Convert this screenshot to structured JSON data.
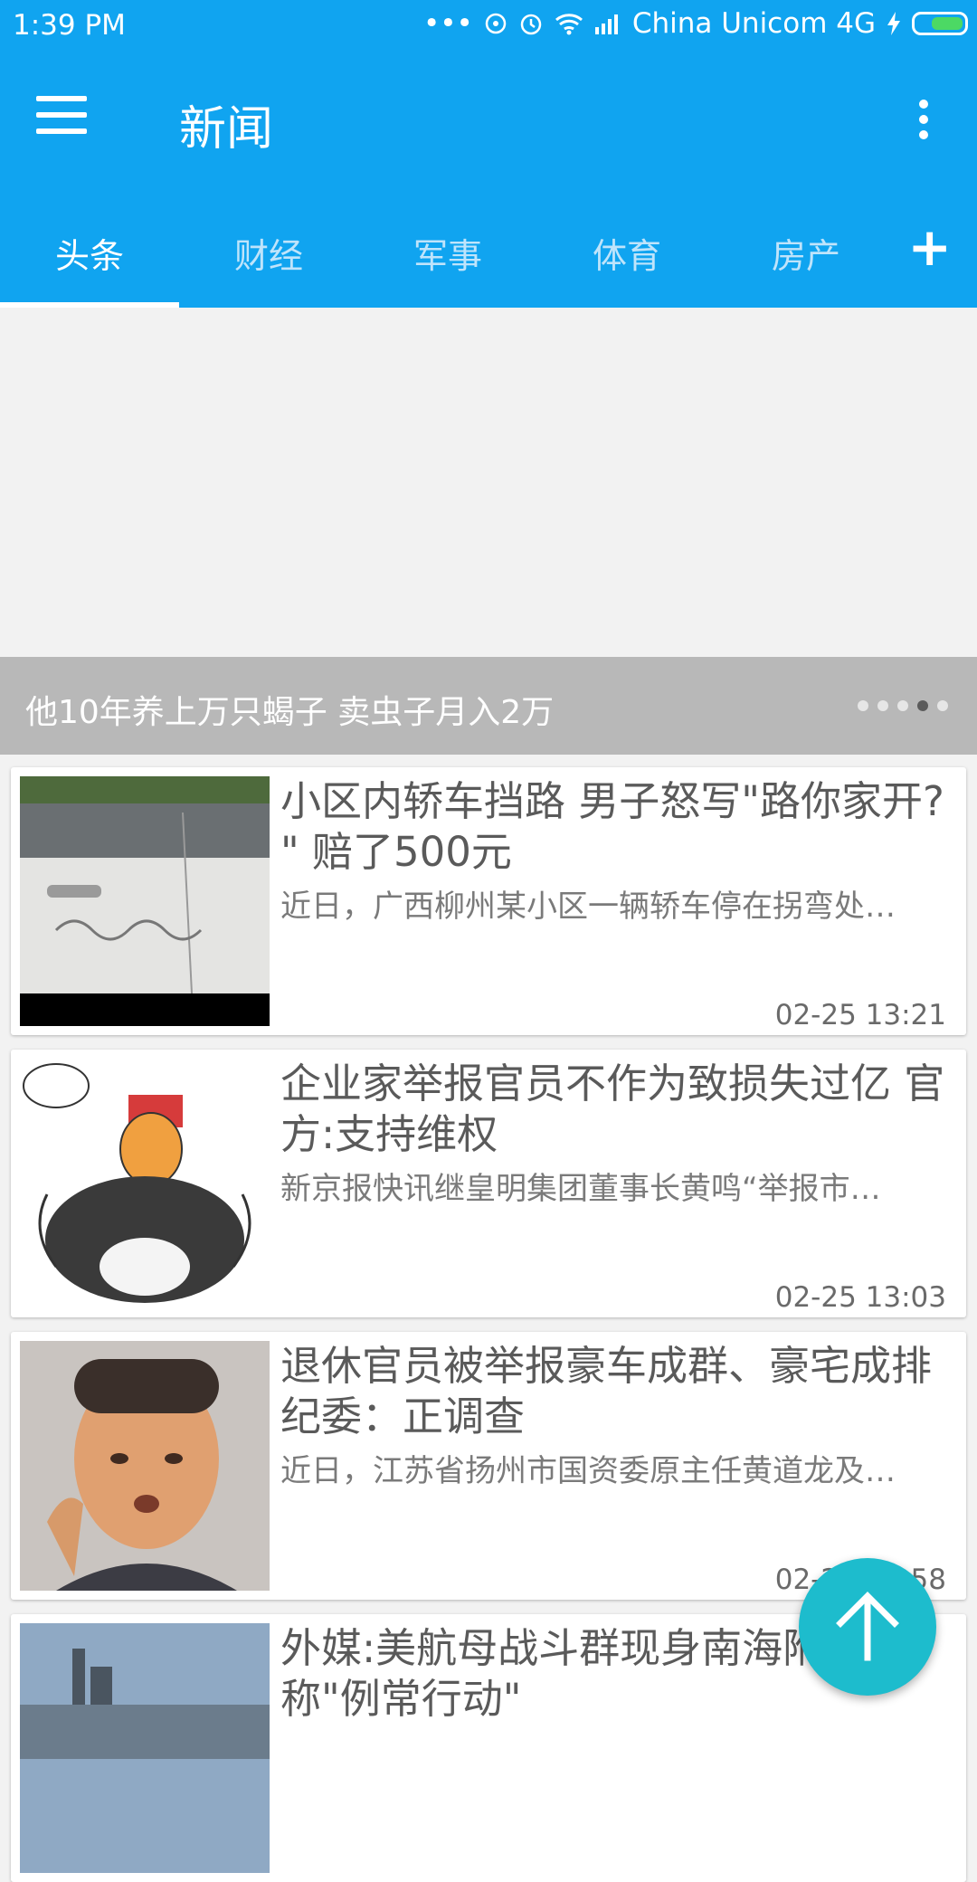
{
  "status_bar": {
    "time": "1:39 PM",
    "carrier": "China Unicom 4G",
    "icons": [
      "more-dots-icon",
      "hotspot-icon",
      "alarm-icon",
      "wifi-icon",
      "signal-icon",
      "charging-bolt-icon",
      "battery-icon"
    ]
  },
  "app_bar": {
    "title": "新闻",
    "menu_icon": "hamburger-menu-icon",
    "overflow_icon": "overflow-menu-icon"
  },
  "tabs": [
    {
      "label": "头条",
      "active": true
    },
    {
      "label": "财经",
      "active": false
    },
    {
      "label": "军事",
      "active": false
    },
    {
      "label": "体育",
      "active": false
    },
    {
      "label": "房产",
      "active": false
    }
  ],
  "add_tab_label": "+",
  "banner": {
    "caption": "他10年养上万只蝎子 卖虫子月入2万",
    "page_count": 5,
    "active_index": 3
  },
  "news": [
    {
      "title": "小区内轿车挡路 男子怒写\"路你家开? \" 赔了500元",
      "summary": "近日，广西柳州某小区一辆轿车停在拐弯处…",
      "time": "02-25 13:21"
    },
    {
      "title": "企业家举报官员不作为致损失过亿 官方:支持维权",
      "summary": "新京报快讯继皇明集团董事长黄鸣“举报市…",
      "time": "02-25 13:03"
    },
    {
      "title": "退休官员被举报豪车成群、豪宅成排 纪委：正调查",
      "summary": "近日，江苏省扬州市国资委原主任黄道龙及…",
      "time": "02-25 12:58"
    },
    {
      "title": "外媒:美航母战斗群现身南海附近 称\"例常行动\"",
      "summary": "",
      "time": ""
    }
  ],
  "colors": {
    "primary": "#10a4f0",
    "fab": "#1dbccd"
  }
}
